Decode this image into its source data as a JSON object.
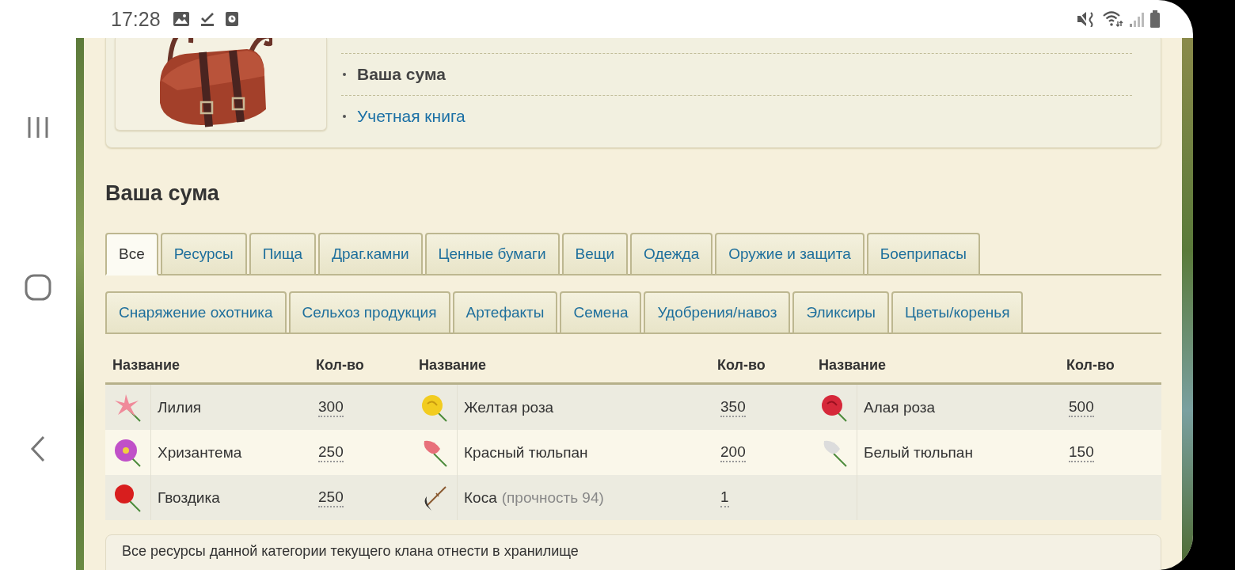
{
  "status_bar": {
    "time": "17:28"
  },
  "top_card": {
    "links": [
      {
        "label": "Ваша сума",
        "selected": true
      },
      {
        "label": "Учетная книга",
        "selected": false
      }
    ]
  },
  "heading": "Ваша сума",
  "tab_rows": [
    [
      {
        "label": "Все",
        "selected": true
      },
      {
        "label": "Ресурсы",
        "selected": false
      },
      {
        "label": "Пища",
        "selected": false
      },
      {
        "label": "Драг.камни",
        "selected": false
      },
      {
        "label": "Ценные бумаги",
        "selected": false
      },
      {
        "label": "Вещи",
        "selected": false
      },
      {
        "label": "Одежда",
        "selected": false
      },
      {
        "label": "Оружие и защита",
        "selected": false
      },
      {
        "label": "Боеприпасы",
        "selected": false
      }
    ],
    [
      {
        "label": "Снаряжение охотника",
        "selected": false
      },
      {
        "label": "Сельхоз продукция",
        "selected": false
      },
      {
        "label": "Артефакты",
        "selected": false
      },
      {
        "label": "Семена",
        "selected": false
      },
      {
        "label": "Удобрения/навоз",
        "selected": false
      },
      {
        "label": "Эликсиры",
        "selected": false
      },
      {
        "label": "Цветы/коренья",
        "selected": false
      }
    ]
  ],
  "table": {
    "columns": [
      "Название",
      "Кол-во",
      "Название",
      "Кол-во",
      "Название",
      "Кол-во"
    ],
    "rows": [
      [
        {
          "name": "Лилия",
          "qty": "300"
        },
        {
          "name": "Желтая роза",
          "qty": "350"
        },
        {
          "name": "Алая роза",
          "qty": "500"
        }
      ],
      [
        {
          "name": "Хризантема",
          "qty": "250"
        },
        {
          "name": "Красный тюльпан",
          "qty": "200"
        },
        {
          "name": "Белый тюльпан",
          "qty": "150"
        }
      ],
      [
        {
          "name": "Гвоздика",
          "qty": "250"
        },
        {
          "name": "Коса",
          "note": "(прочность 94)",
          "qty": "1"
        }
      ]
    ]
  },
  "footer_note": "Все ресурсы данной категории текущего клана отнести в хранилище"
}
